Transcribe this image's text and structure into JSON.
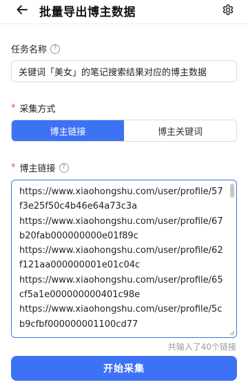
{
  "header": {
    "title": "批量导出博主数据",
    "back_icon": "arrow-left-icon",
    "settings_icon": "gear-icon"
  },
  "task_name": {
    "label": "任务名称",
    "value": "关键词「美女」的笔记搜索结果对应的博主数据"
  },
  "collect_mode": {
    "required_mark": "*",
    "label": "采集方式",
    "options": [
      "博主链接",
      "博主关键词"
    ],
    "selected": "博主链接"
  },
  "blogger_links": {
    "required_mark": "*",
    "label": "博主链接",
    "lines": [
      "https://www.xiaohongshu.com/user/profile/57f3e25f50c4b46e64a73c3a",
      "https://www.xiaohongshu.com/user/profile/67b20fab000000000e01f89c",
      "https://www.xiaohongshu.com/user/profile/62f121aa000000001e01c04c",
      "https://www.xiaohongshu.com/user/profile/65cf5a1e000000000401c98e",
      "https://www.xiaohongshu.com/user/profile/5cb9cfbf000000001100cd77"
    ],
    "count_text": "共输入了40个链接"
  },
  "actions": {
    "start_label": "开始采集"
  },
  "colors": {
    "accent": "#3d72f5",
    "required": "#e34d4d"
  }
}
